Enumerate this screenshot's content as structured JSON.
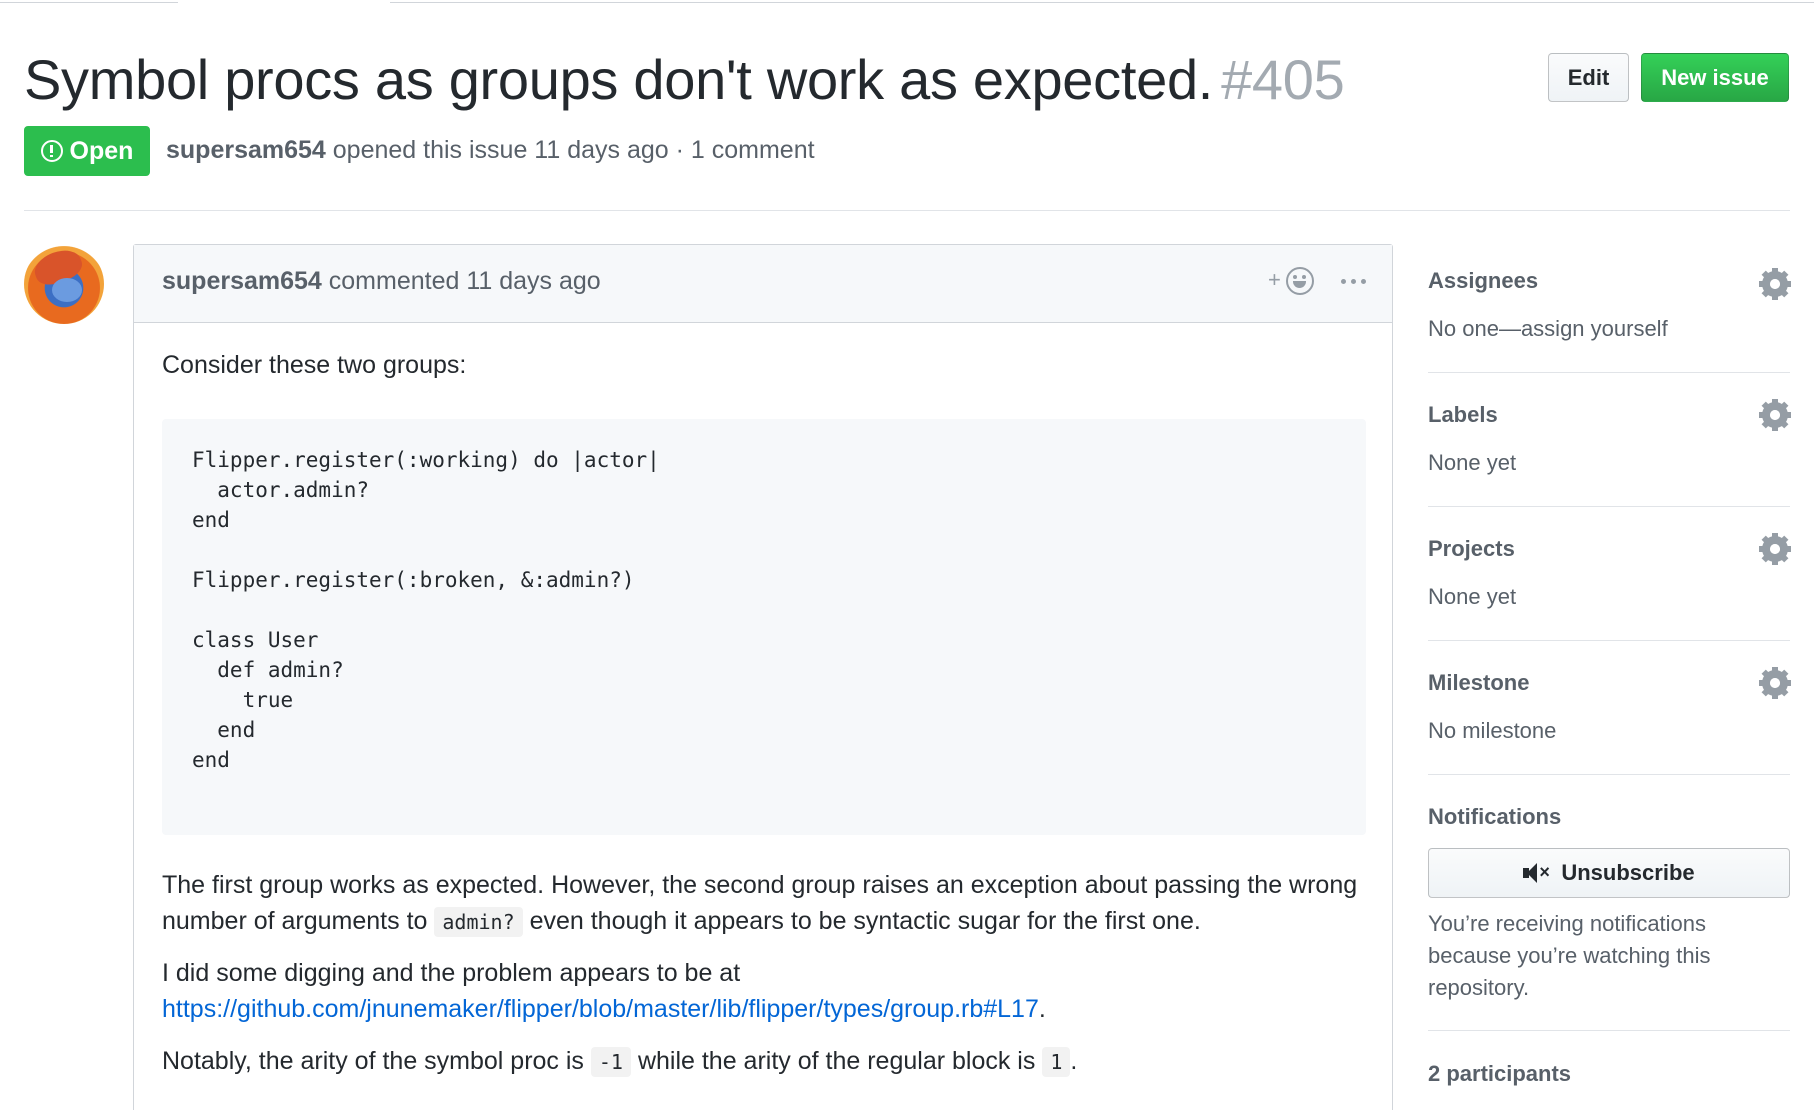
{
  "issue": {
    "title": "Symbol procs as groups don't work as expected.",
    "number": "#405",
    "state": "Open",
    "author": "supersam654",
    "meta_rest": "opened this issue 11 days ago · 1 comment"
  },
  "actions": {
    "edit_label": "Edit",
    "new_issue_label": "New issue"
  },
  "comment": {
    "author": "supersam654",
    "meta_rest": "commented 11 days ago",
    "reaction_plus": "+",
    "intro": "Consider these two groups:",
    "code_lines": [
      "Flipper.register(:working) do |actor|",
      "  actor.admin?",
      "end",
      "",
      "Flipper.register(:broken, &:admin?)",
      "",
      "class User",
      "  def admin?",
      "    true",
      "  end",
      "end"
    ],
    "para2_a": "The first group works as expected. However, the second group raises an exception about passing the wrong number of arguments to",
    "para2_code": "admin?",
    "para2_b": "even though it appears to be syntactic sugar for the first one.",
    "para3_a": "I did some digging and the problem appears to be at",
    "para3_link": "https://github.com/jnunemaker/flipper/blob/master/lib/flipper/types/group.rb#L17",
    "para3_b": ".",
    "para4_a": "Notably, the arity of the symbol proc is",
    "para4_code1": "-1",
    "para4_b": "while the arity of the regular block is",
    "para4_code2": "1",
    "para4_c": "."
  },
  "sidebar": {
    "assignees": {
      "heading": "Assignees",
      "value": "No one—assign yourself"
    },
    "labels": {
      "heading": "Labels",
      "value": "None yet"
    },
    "projects": {
      "heading": "Projects",
      "value": "None yet"
    },
    "milestone": {
      "heading": "Milestone",
      "value": "No milestone"
    },
    "notifications": {
      "heading": "Notifications",
      "button_label": "Unsubscribe",
      "description": "You’re receiving notifications because you’re watching this repository."
    },
    "participants": {
      "heading": "2 participants"
    }
  },
  "colors": {
    "open_green": "#2cbe4e",
    "new_issue_green": "#28a745",
    "link_blue": "#0366d6",
    "muted_text": "#586069",
    "number_gray": "#a3aab1"
  },
  "icons": [
    "issue-opened-icon",
    "add-reaction-icon",
    "kebab-menu-icon",
    "gear-icon",
    "mute-icon",
    "avatar"
  ]
}
